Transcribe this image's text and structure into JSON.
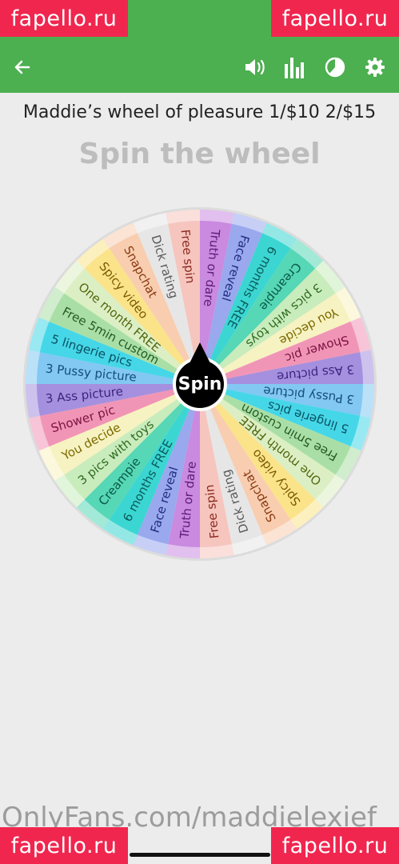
{
  "colors": {
    "app_bar": "#4caf50",
    "watermark_bg": "#f0264f",
    "heading": "#bdbdbd"
  },
  "watermarks": {
    "top_left": "fapello.ru",
    "top_right": "fapello.ru",
    "bottom_left": "fapello.ru",
    "bottom_right": "fapello.ru"
  },
  "toolbar": {
    "back_icon": "arrow-left-icon",
    "sound_icon": "volume-icon",
    "stats_icon": "bar-chart-icon",
    "results_icon": "pie-chart-icon",
    "settings_icon": "gear-icon"
  },
  "wheel": {
    "title": "Maddie’s wheel of pleasure 1/$10 2/$15",
    "heading": "Spin the wheel",
    "spin_label": "Spin",
    "segments": [
      {
        "label": "Dick rating",
        "color": "#e6e6e6",
        "text": "#5a5a5a"
      },
      {
        "label": "Free spin",
        "color": "#f6c5bd",
        "text": "#8a2a20"
      },
      {
        "label": "Truth or dare",
        "color": "#c98ae0",
        "text": "#5d1a78"
      },
      {
        "label": "Face reveal",
        "color": "#9aa8ee",
        "text": "#1f2e80"
      },
      {
        "label": "6 months FREE",
        "color": "#3bd6d2",
        "text": "#0b5a5a"
      },
      {
        "label": "Creampie",
        "color": "#56d7b6",
        "text": "#0a5a45"
      },
      {
        "label": "3 pics with toys",
        "color": "#c9ecbc",
        "text": "#2f6b22"
      },
      {
        "label": "You decide",
        "color": "#f7f2c1",
        "text": "#7a6a00"
      },
      {
        "label": "Shower pic",
        "color": "#f195b6",
        "text": "#7a1240"
      },
      {
        "label": "3 Ass picture",
        "color": "#a490de",
        "text": "#3b2680"
      },
      {
        "label": "3 Pussy picture",
        "color": "#82c8f2",
        "text": "#144c7a"
      },
      {
        "label": "5 lingerie pics",
        "color": "#45d7e8",
        "text": "#0a5160"
      },
      {
        "label": "Free 5min custom",
        "color": "#a9dfa6",
        "text": "#225a22"
      },
      {
        "label": "One month FREE",
        "color": "#dcefc4",
        "text": "#556611"
      },
      {
        "label": "Spicy video",
        "color": "#fbe38a",
        "text": "#7a5a00"
      },
      {
        "label": "Snapchat",
        "color": "#f8cdb0",
        "text": "#8a3a10"
      }
    ]
  },
  "footer": {
    "credit": "OnlyFans.com/maddielexief"
  }
}
